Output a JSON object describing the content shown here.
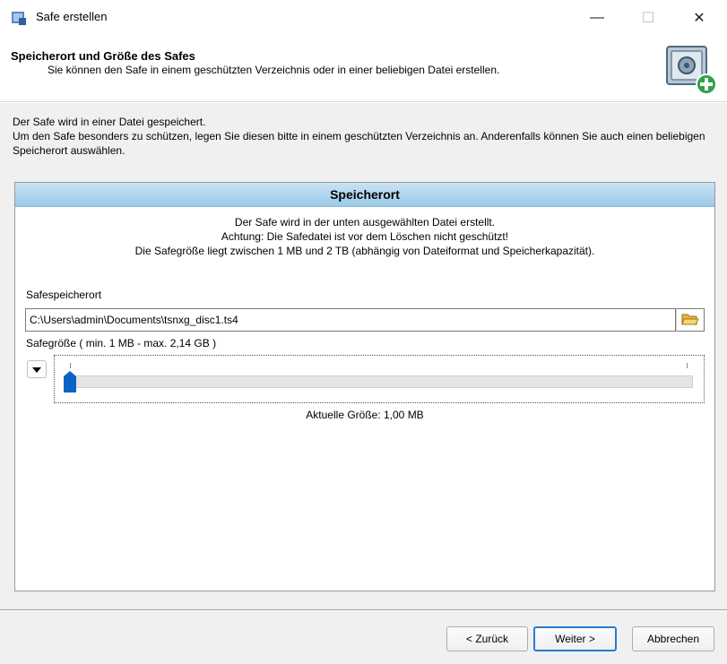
{
  "window": {
    "title": "Safe erstellen",
    "controls": {
      "minimize": "—",
      "maximize": "☐",
      "close": "✕"
    }
  },
  "header": {
    "title": "Speicherort und Größe des Safes",
    "subtitle": "Sie können den Safe in einem geschützten Verzeichnis oder in einer beliebigen Datei erstellen.",
    "icon": "safe-add-icon"
  },
  "description": {
    "line1": "Der Safe wird in einer Datei gespeichert.",
    "line2": "Um den Safe besonders zu schützen, legen Sie diesen bitte in einem geschützten Verzeichnis an. Anderenfalls können Sie auch einen beliebigen Speicherort auswählen."
  },
  "panel": {
    "title": "Speicherort",
    "info1": "Der Safe wird in der unten ausgewählten Datei erstellt.",
    "info2": "Achtung: Die Safedatei ist vor dem Löschen nicht geschützt!",
    "info3": "Die Safegröße liegt zwischen 1 MB und 2 TB (abhängig von Dateiformat und Speicherkapazität).",
    "location_label": "Safespeicherort",
    "location_value": "C:\\Users\\admin\\Documents\\tsnxg_disc1.ts4",
    "size_label": "Safegröße ( min. 1 MB - max. 2,14 GB )",
    "slider_fraction": 0.0,
    "current_size": "Aktuelle Größe: 1,00 MB",
    "accent_color": "#0a64c8"
  },
  "buttons": {
    "back": "< Zurück",
    "next": "Weiter >",
    "cancel": "Abbrechen"
  }
}
